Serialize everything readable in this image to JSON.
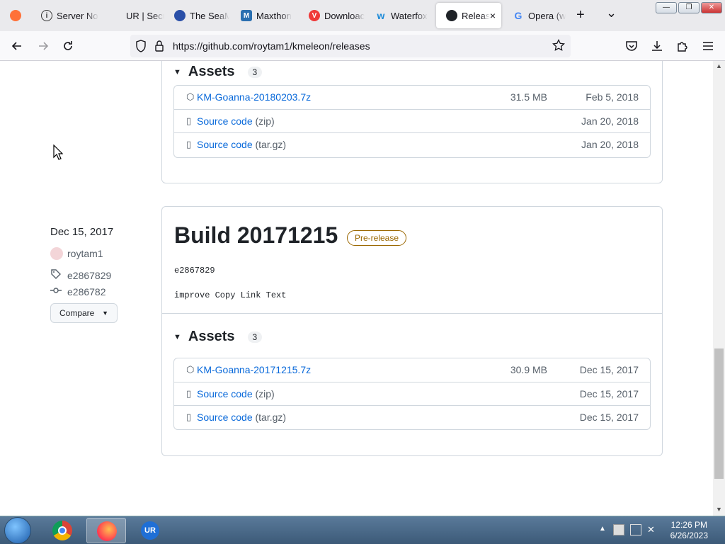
{
  "browser": {
    "tabs": [
      {
        "title": "",
        "icon": "firefox-icon",
        "active": false
      },
      {
        "title": "Server No",
        "icon": "info-icon",
        "active": false
      },
      {
        "title": "UR | Secu",
        "icon": "ur-icon",
        "active": false
      },
      {
        "title": "The SeaM",
        "icon": "seamonkey-icon",
        "active": false
      },
      {
        "title": "Maxthon",
        "icon": "maxthon-icon",
        "active": false
      },
      {
        "title": "Downloac",
        "icon": "vivaldi-icon",
        "active": false
      },
      {
        "title": "Waterfox",
        "icon": "waterfox-icon",
        "active": false
      },
      {
        "title": "Releas",
        "icon": "github-icon",
        "active": true
      },
      {
        "title": "Opera (w",
        "icon": "google-icon",
        "active": false
      }
    ],
    "new_tab": "+",
    "tab_list": "⌄",
    "close_tab": "×",
    "url": "https://github.com/roytam1/kmeleon/releases",
    "window_buttons": {
      "minimize": "—",
      "maximize": "❐",
      "close": "✕"
    }
  },
  "previous_release": {
    "assets_heading": "Assets",
    "assets_count": "3",
    "assets": [
      {
        "name": "KM-Goanna-20180203.7z",
        "format": "",
        "size": "31.5 MB",
        "date": "Feb 5, 2018",
        "icon": "package-icon"
      },
      {
        "name": "Source code",
        "format": "(zip)",
        "size": "",
        "date": "Jan 20, 2018",
        "icon": "file-zip-icon"
      },
      {
        "name": "Source code",
        "format": "(tar.gz)",
        "size": "",
        "date": "Jan 20, 2018",
        "icon": "file-zip-icon"
      }
    ]
  },
  "release": {
    "date": "Dec 15, 2017",
    "author": "roytam1",
    "tag": "e2867829",
    "commit": "e286782",
    "compare_label": "Compare",
    "title": "Build 20171215",
    "badge": "Pre-release",
    "body_commit": "e2867829",
    "body_text": "improve Copy Link Text",
    "assets_heading": "Assets",
    "assets_count": "3",
    "assets": [
      {
        "name": "KM-Goanna-20171215.7z",
        "format": "",
        "size": "30.9 MB",
        "date": "Dec 15, 2017",
        "icon": "package-icon"
      },
      {
        "name": "Source code",
        "format": "(zip)",
        "size": "",
        "date": "Dec 15, 2017",
        "icon": "file-zip-icon"
      },
      {
        "name": "Source code",
        "format": "(tar.gz)",
        "size": "",
        "date": "Dec 15, 2017",
        "icon": "file-zip-icon"
      }
    ]
  },
  "taskbar": {
    "time": "12:26 PM",
    "date": "6/26/2023",
    "apps": [
      "start-orb",
      "chrome-icon",
      "firefox-icon",
      "ur-browser-icon"
    ]
  }
}
